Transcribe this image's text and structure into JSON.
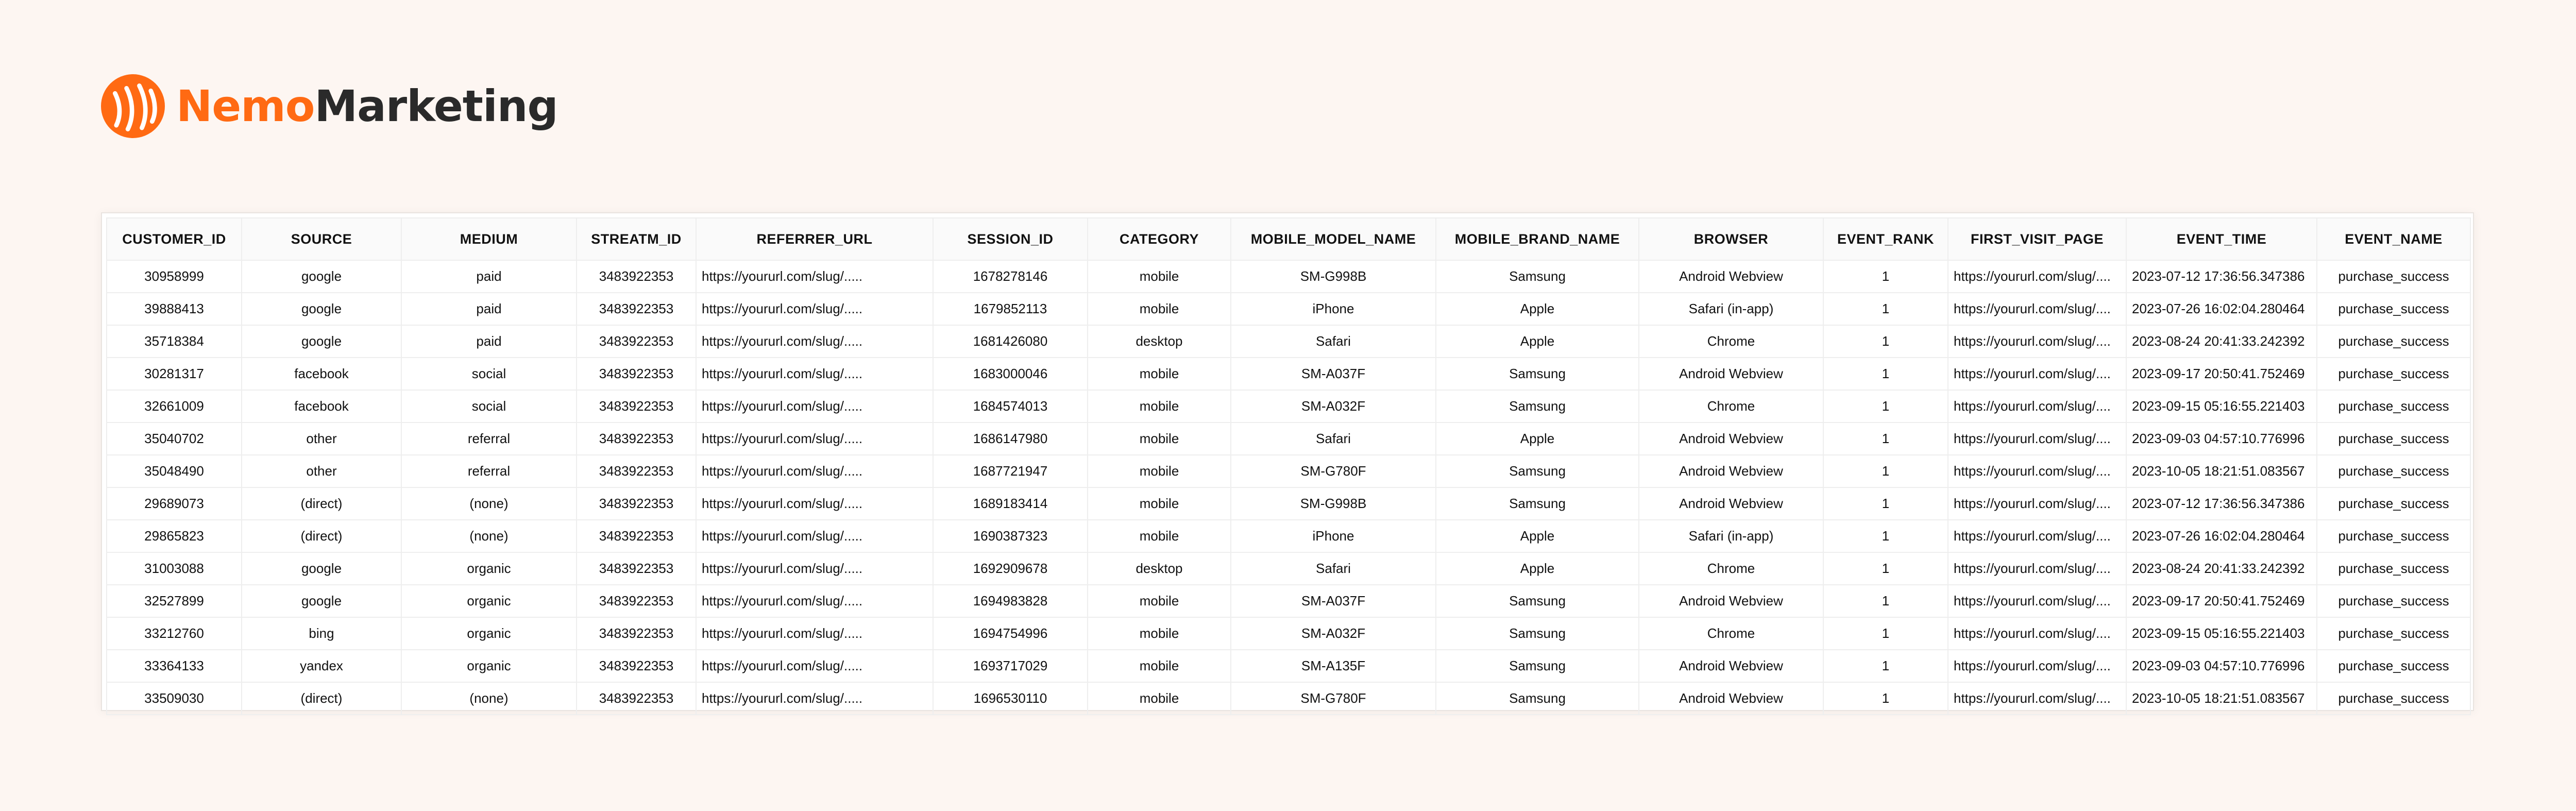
{
  "brand": {
    "name_part1": "Nemo",
    "name_part2": "Marketing",
    "accent": "#ff6a13",
    "logo_icon": "nemo-logo-icon"
  },
  "table": {
    "columns": [
      "CUSTOMER_ID",
      "SOURCE",
      "MEDIUM",
      "STREATM_ID",
      "REFERRER_URL",
      "SESSION_ID",
      "CATEGORY",
      "MOBILE_MODEL_NAME",
      "MOBILE_BRAND_NAME",
      "BROWSER",
      "EVENT_RANK",
      "FIRST_VISIT_PAGE",
      "EVENT_TIME",
      "EVENT_NAME"
    ],
    "rows": [
      [
        "30958999",
        "google",
        "paid",
        "3483922353",
        "https://yoururl.com/slug/.....",
        "1678278146",
        "mobile",
        "SM-G998B",
        "Samsung",
        "Android Webview",
        "1",
        "https://yoururl.com/slug/....",
        "2023-07-12 17:36:56.347386",
        "purchase_success"
      ],
      [
        "39888413",
        "google",
        "paid",
        "3483922353",
        "https://yoururl.com/slug/.....",
        "1679852113",
        "mobile",
        "iPhone",
        "Apple",
        "Safari (in-app)",
        "1",
        "https://yoururl.com/slug/....",
        "2023-07-26 16:02:04.280464",
        "purchase_success"
      ],
      [
        "35718384",
        "google",
        "paid",
        "3483922353",
        "https://yoururl.com/slug/.....",
        "1681426080",
        "desktop",
        "Safari",
        "Apple",
        "Chrome",
        "1",
        "https://yoururl.com/slug/....",
        "2023-08-24 20:41:33.242392",
        "purchase_success"
      ],
      [
        "30281317",
        "facebook",
        "social",
        "3483922353",
        "https://yoururl.com/slug/.....",
        "1683000046",
        "mobile",
        "SM-A037F",
        "Samsung",
        "Android Webview",
        "1",
        "https://yoururl.com/slug/....",
        "2023-09-17 20:50:41.752469",
        "purchase_success"
      ],
      [
        "32661009",
        "facebook",
        "social",
        "3483922353",
        "https://yoururl.com/slug/.....",
        "1684574013",
        "mobile",
        "SM-A032F",
        "Samsung",
        "Chrome",
        "1",
        "https://yoururl.com/slug/....",
        "2023-09-15 05:16:55.221403",
        "purchase_success"
      ],
      [
        "35040702",
        "other",
        "referral",
        "3483922353",
        "https://yoururl.com/slug/.....",
        "1686147980",
        "mobile",
        "Safari",
        "Apple",
        "Android Webview",
        "1",
        "https://yoururl.com/slug/....",
        "2023-09-03 04:57:10.776996",
        "purchase_success"
      ],
      [
        "35048490",
        "other",
        "referral",
        "3483922353",
        "https://yoururl.com/slug/.....",
        "1687721947",
        "mobile",
        "SM-G780F",
        "Samsung",
        "Android Webview",
        "1",
        "https://yoururl.com/slug/....",
        "2023-10-05 18:21:51.083567",
        "purchase_success"
      ],
      [
        "29689073",
        "(direct)",
        "(none)",
        "3483922353",
        "https://yoururl.com/slug/.....",
        "1689183414",
        "mobile",
        "SM-G998B",
        "Samsung",
        "Android Webview",
        "1",
        "https://yoururl.com/slug/....",
        "2023-07-12 17:36:56.347386",
        "purchase_success"
      ],
      [
        "29865823",
        "(direct)",
        "(none)",
        "3483922353",
        "https://yoururl.com/slug/.....",
        "1690387323",
        "mobile",
        "iPhone",
        "Apple",
        "Safari (in-app)",
        "1",
        "https://yoururl.com/slug/....",
        "2023-07-26 16:02:04.280464",
        "purchase_success"
      ],
      [
        "31003088",
        "google",
        "organic",
        "3483922353",
        "https://yoururl.com/slug/.....",
        "1692909678",
        "desktop",
        "Safari",
        "Apple",
        "Chrome",
        "1",
        "https://yoururl.com/slug/....",
        "2023-08-24 20:41:33.242392",
        "purchase_success"
      ],
      [
        "32527899",
        "google",
        "organic",
        "3483922353",
        "https://yoururl.com/slug/.....",
        "1694983828",
        "mobile",
        "SM-A037F",
        "Samsung",
        "Android Webview",
        "1",
        "https://yoururl.com/slug/....",
        "2023-09-17 20:50:41.752469",
        "purchase_success"
      ],
      [
        "33212760",
        "bing",
        "organic",
        "3483922353",
        "https://yoururl.com/slug/.....",
        "1694754996",
        "mobile",
        "SM-A032F",
        "Samsung",
        "Chrome",
        "1",
        "https://yoururl.com/slug/....",
        "2023-09-15 05:16:55.221403",
        "purchase_success"
      ],
      [
        "33364133",
        "yandex",
        "organic",
        "3483922353",
        "https://yoururl.com/slug/.....",
        "1693717029",
        "mobile",
        "SM-A135F",
        "Samsung",
        "Android Webview",
        "1",
        "https://yoururl.com/slug/....",
        "2023-09-03 04:57:10.776996",
        "purchase_success"
      ],
      [
        "33509030",
        "(direct)",
        "(none)",
        "3483922353",
        "https://yoururl.com/slug/.....",
        "1696530110",
        "mobile",
        "SM-G780F",
        "Samsung",
        "Android Webview",
        "1",
        "https://yoururl.com/slug/....",
        "2023-10-05 18:21:51.083567",
        "purchase_success"
      ]
    ]
  }
}
